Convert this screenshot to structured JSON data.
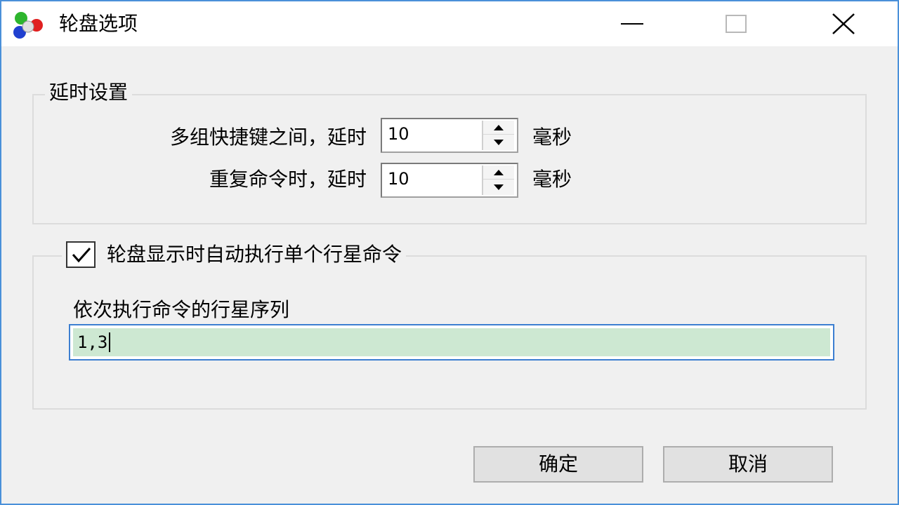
{
  "window": {
    "title": "轮盘选项",
    "controls": {
      "minimize_icon": "minimize-icon",
      "maximize_icon": "maximize-icon",
      "close_icon": "close-icon"
    }
  },
  "delay_group": {
    "legend": "延时设置",
    "hotkey_delay": {
      "label": "多组快捷键之间，延时",
      "value": "10",
      "unit": "毫秒"
    },
    "repeat_delay": {
      "label": "重复命令时，延时",
      "value": "10",
      "unit": "毫秒"
    }
  },
  "auto_group": {
    "checkbox_label": "轮盘显示时自动执行单个行星命令",
    "checked": true,
    "sequence_label": "依次执行命令的行星序列",
    "sequence_value": "1,3"
  },
  "buttons": {
    "ok": "确定",
    "cancel": "取消"
  },
  "colors": {
    "titlebar": "#ffffff",
    "window_border": "#4a90d9",
    "input_highlight": "#cde8d2",
    "focus_border": "#3c7fd1"
  }
}
